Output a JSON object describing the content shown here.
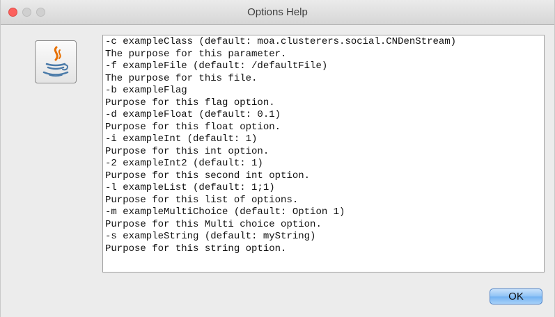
{
  "window": {
    "title": "Options Help",
    "controls": [
      "close",
      "minimize",
      "maximize"
    ]
  },
  "icon": {
    "name": "java-icon"
  },
  "help_text": {
    "lines": [
      "-c exampleClass (default: moa.clusterers.social.CNDenStream)",
      "The purpose for this parameter.",
      "-f exampleFile (default: /defaultFile)",
      "The purpose for this file.",
      "-b exampleFlag",
      "Purpose for this flag option.",
      "-d exampleFloat (default: 0.1)",
      "Purpose for this float option.",
      "-i exampleInt (default: 1)",
      "Purpose for this int option.",
      "-2 exampleInt2 (default: 1)",
      "Purpose for this second int option.",
      "-l exampleList (default: 1;1)",
      "Purpose for this list of options.",
      "-m exampleMultiChoice (default: Option 1)",
      "Purpose for this Multi choice option.",
      "-s exampleString (default: myString)",
      "Purpose for this string option."
    ]
  },
  "buttons": {
    "ok_label": "OK"
  },
  "colors": {
    "close_button": "#fc615d",
    "ok_button_accent": "#8ec2f5",
    "window_background": "#ececec"
  }
}
